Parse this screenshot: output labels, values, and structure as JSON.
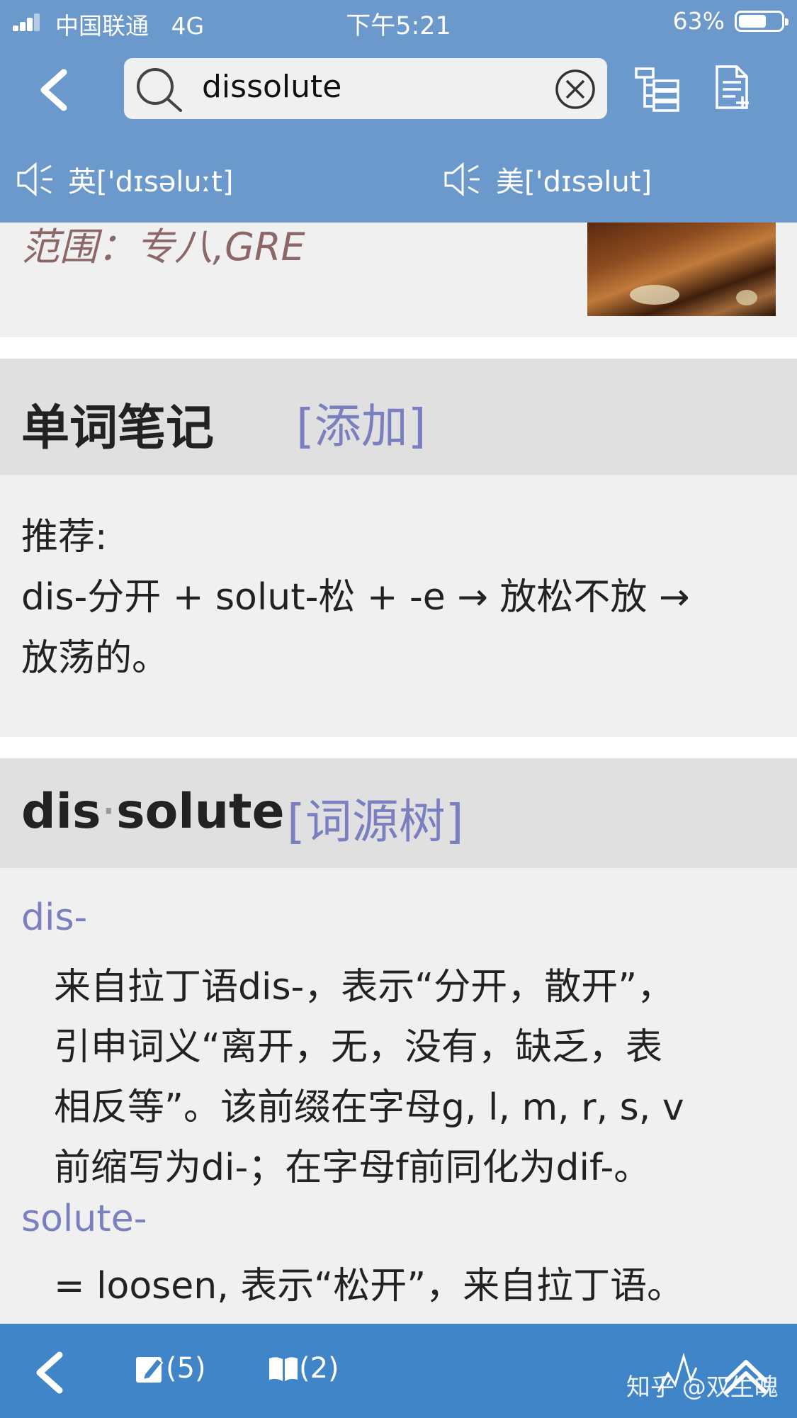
{
  "status_bar": {
    "carrier": "中国联通",
    "network": "4G",
    "time": "下午5:21",
    "battery": "63%",
    "battery_level": 0.63
  },
  "search": {
    "query": "dissolute"
  },
  "pronunciation": {
    "uk": "英['dɪsəluːt]",
    "us": "美['dɪsəlut]"
  },
  "scope_line": "范围：专八,GRE",
  "notes_section": {
    "title": "单词笔记",
    "add_link": "[添加]",
    "recommend_label": "推荐:",
    "recommend_line1": "dis-分开 + solut-松 + -e → 放松不放 →",
    "recommend_line2": "放荡的。"
  },
  "etymology_section": {
    "word_part1": "dis",
    "separator": "·",
    "word_part2": "solute",
    "tree_link": "[词源树]",
    "entries": [
      {
        "prefix": "dis-",
        "lines": [
          "来自拉丁语dis-，表示“分开，散开”，",
          "引申词义“离开，无，没有，缺乏，表",
          "相反等”。该前缀在字母g, l, m, r, s, v",
          "前缩写为di-；在字母f前同化为dif-。"
        ]
      },
      {
        "prefix": "solute-",
        "lines": [
          "= loosen, 表示“松开”，来自拉丁语。"
        ]
      }
    ]
  },
  "footer": {
    "notes_count": "(5)",
    "book_count": "(2)",
    "watermark": "知乎 @双生魄"
  },
  "colors": {
    "header_bg": "#6b99cb",
    "footer_bg": "#3f85c7",
    "link": "#7a7fbf"
  }
}
